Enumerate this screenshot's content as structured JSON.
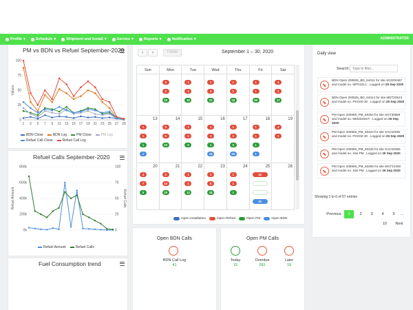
{
  "nav": {
    "items": [
      "Profile",
      "Schedule",
      "Shipment and Install",
      "Service",
      "Reports",
      "Notification"
    ],
    "admin": "ADMINISTRATOR"
  },
  "pm_chart": {
    "title": "PM vs BDN vs Refuel September-2020",
    "ylabel": "Values",
    "legend": [
      "BDN Close",
      "BDN Log",
      "PM Close",
      "PM Log",
      "Refuel Call Close",
      "Refuel Call Log"
    ]
  },
  "refuel_chart": {
    "title": "Refuel Calls September-2020",
    "ylabel_left": "Refuel Amount",
    "ylabel_right": "Refuel Calls",
    "legend": [
      "Refuel Amount",
      "Refuel Calls"
    ]
  },
  "fuel_card": {
    "title": "Fuel Consumption trend"
  },
  "calendar": {
    "title": "September 1 – 30, 2020",
    "prev": "‹",
    "next": "›",
    "today": "TODAY",
    "days": [
      "Sun",
      "Mon",
      "Tue",
      "Wed",
      "Thu",
      "Fri",
      "Sat"
    ],
    "weeks": [
      {
        "nums": [
          "",
          "",
          "",
          "",
          "",
          "",
          ""
        ],
        "pills": [
          [],
          [
            "3",
            "3",
            "20"
          ],
          [
            "1",
            "1",
            "19"
          ],
          [
            "1",
            "4",
            "22"
          ],
          [
            "1",
            "1",
            "18"
          ],
          [
            "1",
            "1",
            "29"
          ],
          [
            "1",
            "1",
            "17"
          ]
        ]
      },
      {
        "nums": [
          "13",
          "14",
          "15",
          "16",
          "17",
          "18",
          "19"
        ],
        "pills": [
          [
            "1",
            "1",
            "1",
            "1"
          ],
          [
            "3",
            "6",
            "20"
          ],
          [
            "1",
            "1",
            "9"
          ],
          [
            "1",
            "1",
            "1",
            "19"
          ],
          [
            "1",
            "1",
            "5",
            "20"
          ],
          [
            "1",
            "1",
            "1",
            "1"
          ],
          [
            "4",
            "1"
          ]
        ]
      },
      {
        "nums": [
          "20",
          "21",
          "22",
          "23",
          "24",
          "25",
          "26"
        ],
        "pills": [
          [
            "4",
            "7",
            "5"
          ],
          [
            "3",
            "13",
            "20"
          ],
          [
            "1",
            "1",
            "12"
          ],
          [
            "1",
            "5",
            "18"
          ],
          [
            "1",
            "1",
            "1"
          ],
          [
            "43",
            "",
            "",
            "19"
          ],
          []
        ]
      }
    ],
    "legend": [
      "Open Installation",
      "Open Refuel",
      "Open PM",
      "Open BDN"
    ],
    "legend_colors": [
      "#3d6fc0",
      "#e34d3c",
      "#2e9b3a",
      "#4a8fe0"
    ]
  },
  "daily_view": {
    "title": "Daily view",
    "search_label": "Search:",
    "search_placeholder": "Type to filter...",
    "items": [
      {
        "head": "BDN Open 200925_BD_64311 for site",
        "body": "SGO00467 and model no. MPG22L1 , Logged on",
        "date": "25 Sep 2020"
      },
      {
        "head": "BDN Open 200925_BD_64314 for site",
        "body": "MDT20513 and model no. PKG0Z-30 , Logged on",
        "date": "25 Sep 2020"
      },
      {
        "head": "PM Open 200906_PM_50354 for site",
        "body": "SGT30859 and model no. MM3020SIT , Logged on",
        "date": "25 Sep 2020"
      },
      {
        "head": "PM Open 200906_PM_50424 for site",
        "body": "SAO10082 and model no. PKG0Z-30 , Logged on",
        "date": "25 Sep 2020"
      },
      {
        "head": "PM Open 200906_PM_50425 for site",
        "body": "SAO10083 and model no. Site PM , Logged on",
        "date": "25 Sep 2020"
      },
      {
        "head": "PM Open 200906_PM_50486 for site",
        "body": "MGT10492 and model no. Site PM , Logged on",
        "date": "25 Sep 2020"
      }
    ],
    "summary": "Showing 1 to 6 of 57 entries",
    "pagination": [
      "Previous",
      "1",
      "2",
      "3",
      "4",
      "5",
      "...",
      "10",
      "Next"
    ]
  },
  "bdn_calls": {
    "title": "Open BDN Calls",
    "label": "BDN Call Log",
    "value": "41"
  },
  "pm_calls": {
    "title": "Open PM Calls",
    "stats": [
      {
        "label": "Today",
        "value": "15"
      },
      {
        "label": "Overdue",
        "value": "281"
      },
      {
        "label": "Later",
        "value": "19"
      }
    ]
  },
  "chart_data": [
    {
      "type": "line",
      "title": "PM vs BDN vs Refuel September-2020",
      "ylabel": "Values",
      "x": [
        1,
        3,
        5,
        7,
        9,
        11,
        13,
        15,
        17,
        19,
        21,
        23,
        25,
        27,
        29
      ],
      "ylim": [
        0,
        100
      ],
      "y_ticks": [
        0,
        25,
        50,
        75,
        100
      ],
      "series": [
        {
          "name": "BDN Close",
          "color": "#3d6fc0",
          "values": [
            3,
            5,
            2,
            8,
            4,
            6,
            5,
            3,
            6,
            4,
            5,
            3,
            4,
            2,
            1
          ]
        },
        {
          "name": "BDN Log",
          "color": "#e07a1f",
          "values": [
            88,
            30,
            15,
            42,
            30,
            52,
            45,
            35,
            40,
            50,
            45,
            30,
            20,
            3,
            2
          ]
        },
        {
          "name": "PM Close",
          "color": "#2e8b2e",
          "values": [
            15,
            12,
            8,
            20,
            18,
            14,
            22,
            12,
            15,
            20,
            18,
            10,
            12,
            3,
            1
          ]
        },
        {
          "name": "PM Log",
          "color": "#a0a8c8",
          "values": [
            20,
            10,
            5,
            15,
            12,
            10,
            18,
            10,
            12,
            15,
            10,
            8,
            10,
            2,
            0
          ]
        },
        {
          "name": "Refuel Call Close",
          "color": "#4a8fe0",
          "values": [
            30,
            20,
            12,
            18,
            16,
            22,
            16,
            12,
            14,
            18,
            16,
            12,
            14,
            3,
            1
          ]
        },
        {
          "name": "Refuel Call Log",
          "color": "#e34d3c",
          "values": [
            100,
            45,
            25,
            50,
            35,
            70,
            60,
            40,
            55,
            65,
            55,
            35,
            30,
            5,
            2
          ]
        }
      ]
    },
    {
      "type": "line",
      "title": "Refuel Calls September-2020",
      "x": [
        1,
        3,
        5,
        7,
        9,
        11,
        13,
        15,
        17,
        19,
        21,
        23,
        25,
        27,
        29
      ],
      "y_left_ticks": [
        "0k",
        "200k",
        "400k",
        "600k",
        "800k"
      ],
      "y_right_ticks": [
        0,
        25,
        50,
        75,
        100
      ],
      "series": [
        {
          "name": "Refuel Amount",
          "color": "#4a8fe0",
          "axis": "left",
          "values": [
            30,
            20,
            10,
            5,
            25,
            10,
            600,
            40,
            500,
            20,
            15,
            10,
            5,
            0,
            0
          ]
        },
        {
          "name": "Refuel Calls",
          "color": "#2e7a2e",
          "axis": "right",
          "values": [
            85,
            30,
            25,
            20,
            30,
            35,
            60,
            50,
            55,
            25,
            20,
            15,
            10,
            2,
            1
          ]
        }
      ]
    }
  ]
}
